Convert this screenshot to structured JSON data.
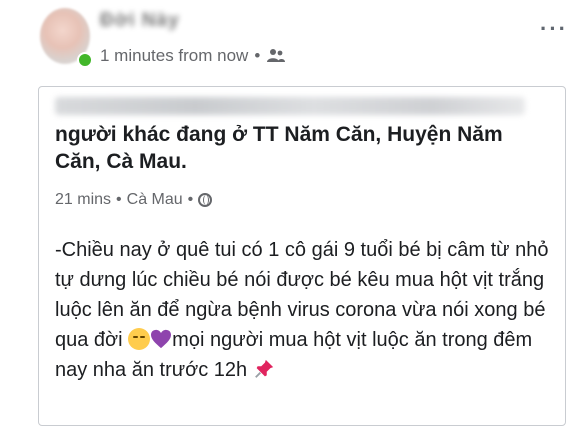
{
  "header": {
    "author_name": "Đời Này",
    "timestamp": "1 minutes from now",
    "separator": "•",
    "privacy_icon": "friends-icon",
    "more_icon": "more-options-icon",
    "more_glyph": "···"
  },
  "shared_post": {
    "activity": "người khác đang ở TT Năm Căn, Huyện Năm Căn, Cà Mau.",
    "meta": {
      "time": "21 mins",
      "separator1": "•",
      "location": "Cà Mau",
      "separator2": "•",
      "privacy_icon": "globe-icon"
    },
    "body": {
      "part1": "-Chiều nay ở quê tui có 1 cô gái 9 tuổi bé bị câm từ nhỏ tự dưng lúc chiều bé nói được bé kêu mua hột vịt trắng luộc lên ăn để ngừa bệnh virus corona vừa nói xong bé qua đời ",
      "part2": "mọi người mua hột vịt luộc ăn trong đêm nay nha ăn trước 12h "
    }
  },
  "colors": {
    "online": "#42b72a",
    "meta_text": "#65676b",
    "heart": "#8e44ad",
    "pin": "#e0245e"
  }
}
